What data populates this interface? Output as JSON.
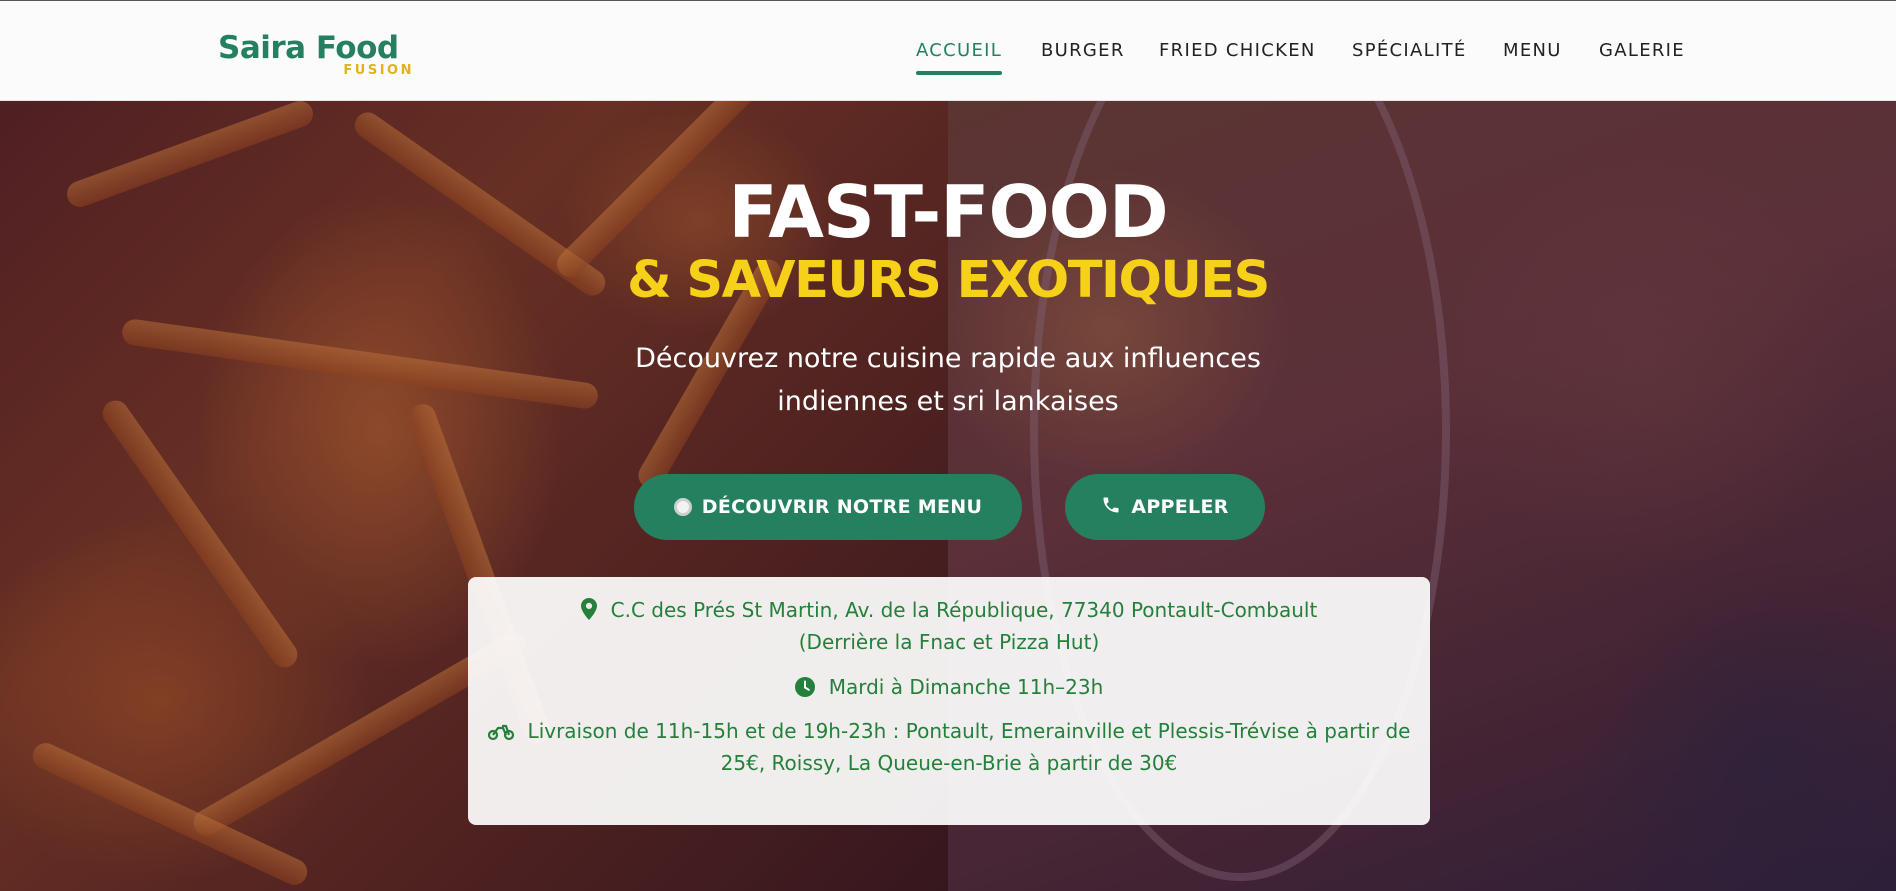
{
  "header": {
    "logo_main": "Saira Food",
    "logo_sub": "FUSION",
    "nav": [
      {
        "label": "ACCUEIL"
      },
      {
        "label": "BURGER"
      },
      {
        "label": "FRIED CHICKEN"
      },
      {
        "label": "SPÉCIALITÉ"
      },
      {
        "label": "MENU"
      },
      {
        "label": "GALERIE"
      }
    ],
    "active_nav": "ACCUEIL"
  },
  "hero": {
    "title": "FAST-FOOD",
    "subtitle": "& SAVEURS EXOTIQUES",
    "description_line1": "Découvrez notre cuisine rapide aux influences",
    "description_line2": "indiennes et sri lankaises",
    "btn_menu": "DÉCOUVRIR NOTRE MENU",
    "btn_call": "APPELER"
  },
  "info": {
    "address_line1": "C.C des Prés St Martin, Av. de la République, 77340 Pontault-Combault",
    "address_line2": "(Derrière la Fnac et Pizza Hut)",
    "hours": "Mardi à Dimanche 11h–23h",
    "delivery_line1": "Livraison de 11h-15h et de 19h-23h : Pontault, Emerainville et Plessis-Trévise à partir de",
    "delivery_line2": "25€, Roissy, La Queue-en-Brie à partir de 30€"
  },
  "icons": {
    "location": "map-pin-icon",
    "hours": "clock-icon",
    "delivery": "motorcycle-icon",
    "menu_button": "plate-icon",
    "call_button": "phone-icon"
  },
  "colors": {
    "brand_green": "#24805f",
    "brand_yellow": "#f6d11a",
    "logo_yellow": "#e0b21c",
    "info_text": "#24803a"
  }
}
